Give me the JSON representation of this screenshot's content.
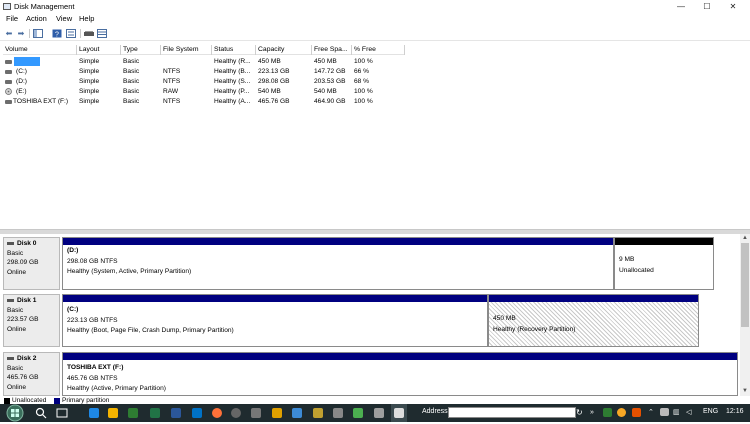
{
  "window": {
    "title": "Disk Management"
  },
  "window_controls": {
    "minimize": "—",
    "maximize": "☐",
    "close": "✕"
  },
  "menu": [
    "File",
    "Action",
    "View",
    "Help"
  ],
  "toolbar_icons": [
    "back-arrow",
    "forward-arrow",
    "console-tree",
    "help",
    "properties",
    "disk-list"
  ],
  "volume_list": {
    "columns": [
      "Volume",
      "Layout",
      "Type",
      "File System",
      "Status",
      "Capacity",
      "Free Spa...",
      "% Free"
    ],
    "rows": [
      {
        "volume": "",
        "layout": "Simple",
        "type": "Basic",
        "fs": "",
        "status": "Healthy (R...",
        "capacity": "450 MB",
        "free": "450 MB",
        "pct": "100 %",
        "selected": true
      },
      {
        "volume": "(C:)",
        "layout": "Simple",
        "type": "Basic",
        "fs": "NTFS",
        "status": "Healthy (B...",
        "capacity": "223.13 GB",
        "free": "147.72 GB",
        "pct": "66 %"
      },
      {
        "volume": "(D:)",
        "layout": "Simple",
        "type": "Basic",
        "fs": "NTFS",
        "status": "Healthy (S...",
        "capacity": "298.08 GB",
        "free": "203.53 GB",
        "pct": "68 %"
      },
      {
        "volume": "(E:)",
        "layout": "Simple",
        "type": "Basic",
        "fs": "RAW",
        "status": "Healthy (P...",
        "capacity": "540 MB",
        "free": "540 MB",
        "pct": "100 %"
      },
      {
        "volume": "TOSHIBA EXT (F:)",
        "layout": "Simple",
        "type": "Basic",
        "fs": "NTFS",
        "status": "Healthy (A...",
        "capacity": "465.76 GB",
        "free": "464.90 GB",
        "pct": "100 %"
      }
    ]
  },
  "disks": [
    {
      "name": "Disk 0",
      "type": "Basic",
      "size": "298.09 GB",
      "state": "Online",
      "partitions": [
        {
          "label": "(D:)",
          "size": "298.08 GB NTFS",
          "status": "Healthy (System, Active, Primary Partition)"
        },
        {
          "label": "",
          "size": "9 MB",
          "status": "Unallocated"
        }
      ]
    },
    {
      "name": "Disk 1",
      "type": "Basic",
      "size": "223.57 GB",
      "state": "Online",
      "partitions": [
        {
          "label": "(C:)",
          "size": "223.13 GB NTFS",
          "status": "Healthy (Boot, Page File, Crash Dump, Primary Partition)"
        },
        {
          "label": "",
          "size": "450 MB",
          "status": "Healthy (Recovery Partition)"
        }
      ]
    },
    {
      "name": "Disk 2",
      "type": "Basic",
      "size": "465.76 GB",
      "state": "Online",
      "partitions": [
        {
          "label": "TOSHIBA EXT  (F:)",
          "size": "465.76 GB NTFS",
          "status": "Healthy (Active, Primary Partition)"
        }
      ]
    }
  ],
  "legend": {
    "unallocated": "Unallocated",
    "primary": "Primary partition"
  },
  "colors": {
    "primary": "#000080",
    "unallocated": "#000000",
    "selection": "#3399ff",
    "taskbar": "#1f2b2f"
  },
  "taskbar": {
    "address_label": "Address",
    "address_value": "",
    "lang": "ENG",
    "time": "12:16"
  }
}
